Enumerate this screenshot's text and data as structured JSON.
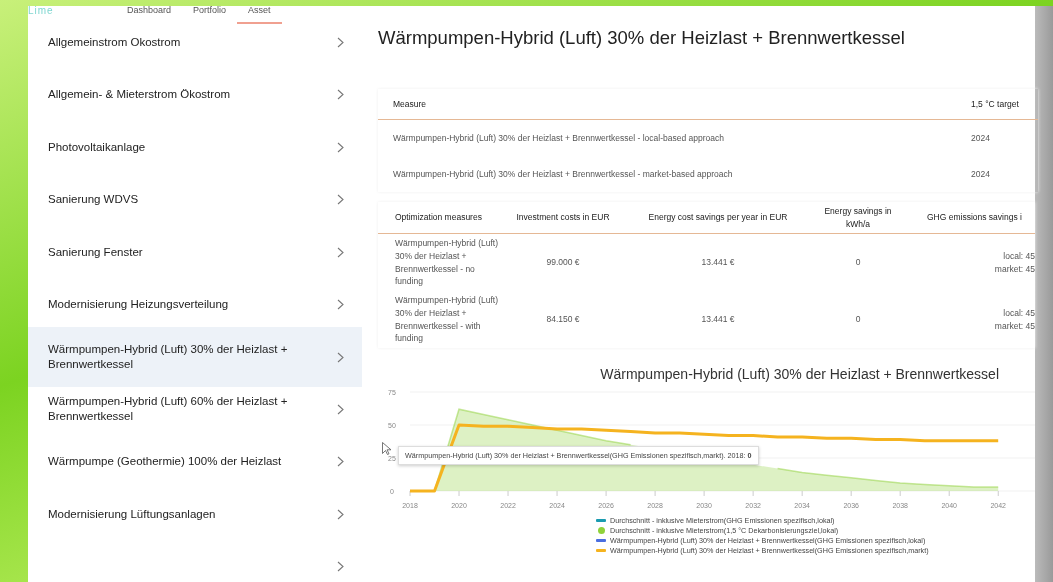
{
  "nav": {
    "logo": "Lime",
    "tabs": [
      {
        "label": "Dashboard",
        "selected": false
      },
      {
        "label": "Portfolio",
        "selected": false
      },
      {
        "label": "Asset",
        "selected": true
      }
    ]
  },
  "sidebar": {
    "items": [
      {
        "label": "Allgemeinstrom Okostrom",
        "selected": false
      },
      {
        "label": "Allgemein- & Mieterstrom Ökostrom",
        "selected": false
      },
      {
        "label": "Photovoltaikanlage",
        "selected": false
      },
      {
        "label": "Sanierung WDVS",
        "selected": false
      },
      {
        "label": "Sanierung Fenster",
        "selected": false
      },
      {
        "label": "Modernisierung Heizungsverteilung",
        "selected": false
      },
      {
        "label": "Wärmpumpen-Hybrid (Luft) 30% der Heizlast + Brennwertkessel",
        "selected": true
      },
      {
        "label": "Wärmpumpen-Hybrid (Luft) 60% der Heizlast + Brennwertkessel",
        "selected": false
      },
      {
        "label": "Wärmpumpe (Geothermie) 100% der Heizlast",
        "selected": false
      },
      {
        "label": "Modernisierung Lüftungsanlagen",
        "selected": false
      }
    ]
  },
  "main": {
    "title": "Wärmpumpen-Hybrid (Luft) 30% der Heizlast + Brennwertkessel",
    "target_table": {
      "columns": [
        "Measure",
        "1,5 °C target"
      ],
      "rows": [
        [
          "Wärmpumpen-Hybrid (Luft) 30% der Heizlast + Brennwertkessel - local-based approach",
          "2024"
        ],
        [
          "Wärmpumpen-Hybrid (Luft) 30% der Heizlast + Brennwertkessel - market-based approach",
          "2024"
        ]
      ]
    },
    "measures_table": {
      "columns": [
        "Optimization measures",
        "Investment costs in EUR",
        "Energy cost savings per year in EUR",
        "Energy savings in kWh/a",
        "GHG emissions savings i"
      ],
      "rows": [
        [
          "Wärmpumpen-Hybrid (Luft) 30% der Heizlast + Brennwertkessel - no funding",
          "99.000 €",
          "13.441 €",
          "0",
          "local: 45\nmarket: 45"
        ],
        [
          "Wärmpumpen-Hybrid (Luft) 30% der Heizlast + Brennwertkessel - with funding",
          "84.150 €",
          "13.441 €",
          "0",
          "local: 45\nmarket: 45"
        ]
      ]
    },
    "chart": {
      "tooltip": "Wärmpumpen-Hybrid (Luft) 30% der Heizlast + Brennwertkessel(GHG Emissionen spezifisch,markt). 2018: **0**",
      "chart_data": {
        "type": "line",
        "title": "Wärmpumpen-Hybrid (Luft) 30% der Heizlast + Brennwertkessel",
        "x": [
          2018,
          2019,
          2020,
          2021,
          2022,
          2023,
          2024,
          2025,
          2026,
          2027,
          2028,
          2029,
          2030,
          2031,
          2032,
          2033,
          2034,
          2035,
          2036,
          2037,
          2038,
          2039,
          2040,
          2041,
          2042
        ],
        "xlim": [
          2018,
          2043.5
        ],
        "legend": "bottom",
        "xticks": [
          2018,
          2020,
          2022,
          2024,
          2026,
          2028,
          2030,
          2032,
          2034,
          2036,
          2038,
          2040,
          2042
        ],
        "yticks": [
          0,
          25,
          50,
          75
        ],
        "ylim": [
          0,
          75
        ],
        "series": [
          {
            "name": "Durchschnitt - inklusive Mieterstrom(GHG Emissionen spezifisch,lokal)",
            "type": "line",
            "color": "#1a9bb0",
            "values": [
              null,
              null,
              null,
              null,
              null,
              null,
              null,
              null,
              null,
              null,
              null,
              null,
              null,
              null,
              null,
              null,
              null,
              null,
              null,
              null,
              null,
              null,
              null,
              null,
              null
            ]
          },
          {
            "name": "Durchschnitt - inklusive Mieterstrom(1,5 °C Dekarbonisierungsziel,lokal)",
            "type": "area",
            "color": "#8fd23a",
            "values": [
              0,
              0,
              62,
              58,
              54,
              50,
              46,
              42,
              38,
              35,
              null,
              null,
              null,
              null,
              null,
              17,
              14,
              12,
              10,
              8,
              6,
              5,
              4,
              3,
              3
            ]
          },
          {
            "name": "Wärmpumpen-Hybrid (Luft) 30% der Heizlast + Brennwertkessel(GHG Emissionen spezifisch,lokal)",
            "type": "line",
            "color": "#4a6ee0",
            "values": [
              null,
              null,
              null,
              null,
              null,
              null,
              null,
              null,
              null,
              null,
              null,
              null,
              null,
              null,
              null,
              null,
              null,
              null,
              null,
              null,
              null,
              null,
              null,
              null,
              null
            ]
          },
          {
            "name": "Wärmpumpen-Hybrid (Luft) 30% der Heizlast + Brennwertkessel(GHG Emissionen spezifisch,markt)",
            "type": "line",
            "color": "#f5b31f",
            "values": [
              0,
              0,
              50,
              49,
              49,
              48,
              47,
              47,
              46,
              45,
              44,
              44,
              43,
              42,
              42,
              41,
              41,
              40,
              40,
              39,
              39,
              38,
              38,
              38,
              38
            ]
          }
        ]
      }
    }
  }
}
